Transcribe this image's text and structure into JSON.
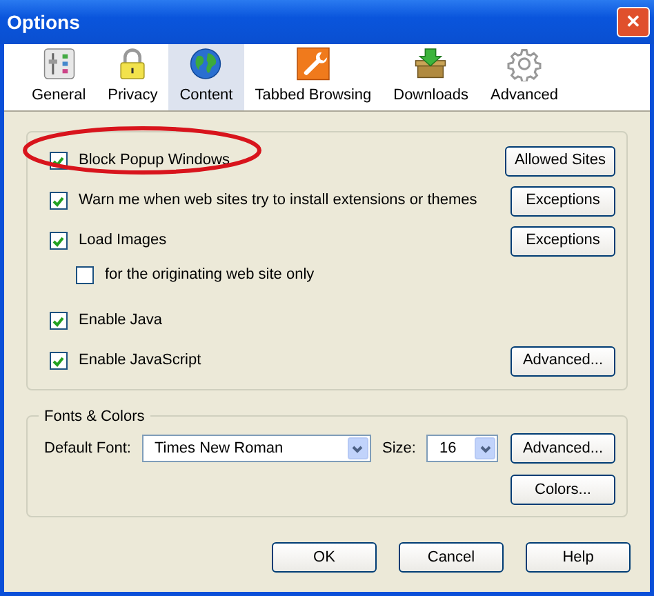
{
  "window": {
    "title": "Options",
    "close": "✕"
  },
  "tabs": [
    {
      "label": "General",
      "selected": false
    },
    {
      "label": "Privacy",
      "selected": false
    },
    {
      "label": "Content",
      "selected": true
    },
    {
      "label": "Tabbed Browsing",
      "selected": false
    },
    {
      "label": "Downloads",
      "selected": false
    },
    {
      "label": "Advanced",
      "selected": false
    }
  ],
  "content_options": [
    {
      "label": "Block Popup Windows",
      "checked": true,
      "button": "Allowed Sites"
    },
    {
      "label": "Warn me when web sites try to install extensions or themes",
      "checked": true,
      "button": "Exceptions"
    },
    {
      "label": "Load Images",
      "checked": true,
      "button": "Exceptions",
      "children": [
        {
          "label": "for the originating web site only",
          "checked": false
        }
      ]
    },
    {
      "label": "Enable Java",
      "checked": true
    },
    {
      "label": "Enable JavaScript",
      "checked": true,
      "button": "Advanced..."
    }
  ],
  "fonts_colors": {
    "title": "Fonts & Colors",
    "default_font_label": "Default Font:",
    "default_font": "Times New Roman",
    "size_label": "Size:",
    "size": "16",
    "buttons": [
      "Advanced...",
      "Colors..."
    ]
  },
  "annotation": {
    "kind": "ellipse",
    "color": "#d8141c"
  },
  "buttons": [
    "OK",
    "Cancel",
    "Help"
  ]
}
